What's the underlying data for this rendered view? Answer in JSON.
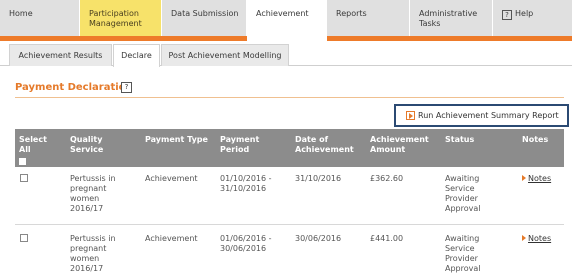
{
  "nav": {
    "tabs": [
      {
        "label": "Home"
      },
      {
        "label": "Participation Management"
      },
      {
        "label": "Data Submission"
      },
      {
        "label": "Achievement"
      },
      {
        "label": "Reports"
      },
      {
        "label": "Administrative Tasks"
      },
      {
        "label": "Help",
        "help_glyph": "?"
      }
    ],
    "active_tab": "Achievement"
  },
  "subtabs": [
    {
      "label": "Achievement Results"
    },
    {
      "label": "Declare"
    },
    {
      "label": "Post Achievement Modelling"
    }
  ],
  "active_subtab": "Declare",
  "section": {
    "title": "Payment Declaration",
    "help_glyph": "?"
  },
  "report_button": {
    "label": "Run Achievement Summary Report"
  },
  "table": {
    "headers": {
      "select_all": "Select All",
      "quality_service": "Quality Service",
      "payment_type": "Payment Type",
      "payment_period": "Payment Period",
      "date_of_achievement": "Date of Achievement",
      "achievement_amount": "Achievement Amount",
      "status": "Status",
      "notes": "Notes"
    },
    "rows": [
      {
        "quality_service": "Pertussis in pregnant women 2016/17",
        "payment_type": "Achievement",
        "payment_period": "01/10/2016 - 31/10/2016",
        "date_of_achievement": "31/10/2016",
        "achievement_amount": "£362.60",
        "status": "Awaiting Service Provider Approval",
        "notes_label": "Notes"
      },
      {
        "quality_service": "Pertussis in pregnant women 2016/17",
        "payment_type": "Achievement",
        "payment_period": "01/06/2016 - 30/06/2016",
        "date_of_achievement": "30/06/2016",
        "achievement_amount": "£441.00",
        "status": "Awaiting Service Provider Approval",
        "notes_label": "Notes"
      }
    ]
  },
  "colors": {
    "accent_orange": "#ee7b2a",
    "participation_yellow": "#f7e26a",
    "table_header_grey": "#8c8c8c",
    "highlight_border_navy": "#2b4a73"
  },
  "icons": [
    "help-icon",
    "play-arrow-icon",
    "notes-arrow-icon",
    "checkbox-icon"
  ]
}
